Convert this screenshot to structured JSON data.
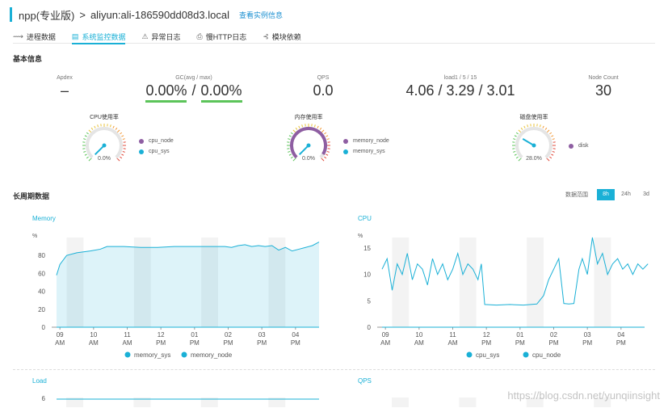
{
  "header": {
    "app_title": "npp(专业版)",
    "separator": ">",
    "host": "aliyun:ali-186590dd08d3.local",
    "instance_link": "查看实例信息"
  },
  "tabs": [
    {
      "label": "进程数据",
      "icon": "pulse-icon",
      "glyph": "⟿"
    },
    {
      "label": "系统监控数据",
      "icon": "list-icon",
      "glyph": "▤",
      "active": true
    },
    {
      "label": "异常日志",
      "icon": "warning-icon",
      "glyph": "⚠"
    },
    {
      "label": "慢HTTP日志",
      "icon": "printer-icon",
      "glyph": "⎙"
    },
    {
      "label": "模块依赖",
      "icon": "share-icon",
      "glyph": "⊰"
    }
  ],
  "basic": {
    "section_title": "基本信息",
    "apdex": {
      "label": "Apdex",
      "value": "–"
    },
    "gc": {
      "label": "GC(avg / max)",
      "avg": "0.00%",
      "slash": "/",
      "max": "0.00%"
    },
    "qps": {
      "label": "QPS",
      "value": "0.0"
    },
    "load": {
      "label": "load1 / 5 / 15",
      "value": "4.06 / 3.29 / 3.01"
    },
    "node_count": {
      "label": "Node Count",
      "value": "30"
    }
  },
  "gauges": [
    {
      "title": "CPU使用率",
      "value_text": "0.0%",
      "value": 0.0,
      "fill": 0.0,
      "legend": [
        {
          "label": "cpu_node",
          "color": "#8e5ea2"
        },
        {
          "label": "cpu_sys",
          "color": "#1ab0d6"
        }
      ]
    },
    {
      "title": "内存使用率",
      "value_text": "0.0%",
      "value": 0.0,
      "fill": 0.95,
      "legend": [
        {
          "label": "memory_node",
          "color": "#8e5ea2"
        },
        {
          "label": "memory_sys",
          "color": "#1ab0d6"
        }
      ]
    },
    {
      "title": "磁盘使用率",
      "value_text": "28.0%",
      "value": 28.0,
      "fill": 0.0,
      "legend": [
        {
          "label": "disk",
          "color": "#8e5ea2"
        }
      ]
    }
  ],
  "long_period": {
    "section_title": "长周期数据",
    "range_label": "数据范围",
    "ranges": [
      "8h",
      "24h",
      "3d"
    ],
    "active_range": "8h"
  },
  "colors": {
    "accent": "#1ab0d6",
    "gc_underline": "#5cc45a",
    "node": "#8e5ea2"
  },
  "chart_data": [
    {
      "type": "area",
      "title": "Memory",
      "ylabel": "%",
      "ylim": [
        0,
        100
      ],
      "yticks": [
        0,
        20,
        40,
        60,
        80
      ],
      "xticks": [
        "09\nAM",
        "10\nAM",
        "11\nAM",
        "12\nPM",
        "01\nPM",
        "02\nPM",
        "03\nPM",
        "04\nPM"
      ],
      "x": [
        0,
        0.1,
        0.3,
        0.6,
        1,
        1.3,
        1.5,
        2,
        2.5,
        3,
        3.5,
        4,
        4.5,
        5,
        5.2,
        5.4,
        5.6,
        5.8,
        6.0,
        6.2,
        6.4,
        6.6,
        6.8,
        7.0,
        7.2,
        7.4,
        7.6,
        7.8
      ],
      "series": [
        {
          "name": "memory_sys",
          "values": [
            58,
            70,
            80,
            83,
            85,
            87,
            90,
            90,
            89,
            89,
            90,
            90,
            90,
            90,
            89,
            91,
            92,
            90,
            91,
            90,
            91,
            86,
            89,
            85,
            87,
            89,
            91,
            95
          ]
        },
        {
          "name": "memory_node",
          "values": [
            0,
            0,
            0,
            0,
            0,
            0,
            0,
            0,
            0,
            0,
            0,
            0,
            0,
            0,
            0,
            0,
            0,
            0,
            0,
            0,
            0,
            0,
            0,
            0,
            0,
            0,
            0,
            0
          ]
        }
      ],
      "legend": [
        "memory_sys",
        "memory_node"
      ]
    },
    {
      "type": "line",
      "title": "CPU",
      "ylabel": "%",
      "ylim": [
        0,
        17
      ],
      "yticks": [
        0,
        5,
        10,
        15
      ],
      "xticks": [
        "09\nAM",
        "10\nAM",
        "11\nAM",
        "12\nPM",
        "01\nPM",
        "02\nPM",
        "03\nPM",
        "04\nPM"
      ],
      "x": [
        0,
        0.15,
        0.3,
        0.45,
        0.6,
        0.75,
        0.9,
        1.05,
        1.2,
        1.35,
        1.5,
        1.65,
        1.8,
        1.95,
        2.1,
        2.25,
        2.4,
        2.55,
        2.7,
        2.85,
        2.95,
        3.05,
        3.4,
        3.8,
        4.2,
        4.6,
        4.8,
        4.95,
        5.1,
        5.25,
        5.4,
        5.55,
        5.7,
        5.85,
        5.95,
        6.1,
        6.25,
        6.4,
        6.55,
        6.7,
        6.85,
        7.0,
        7.15,
        7.3,
        7.45,
        7.6,
        7.75,
        7.9
      ],
      "series": [
        {
          "name": "cpu_sys",
          "values": [
            11,
            13,
            7,
            12,
            10,
            14,
            9,
            12,
            11,
            8,
            13,
            10,
            12,
            9,
            11,
            14,
            10,
            12,
            11,
            9,
            12,
            4.3,
            4.2,
            4.3,
            4.2,
            4.4,
            6,
            9,
            11,
            13,
            4.5,
            4.4,
            4.5,
            11,
            13,
            10,
            17,
            12,
            14,
            10,
            12,
            13,
            11,
            12,
            10,
            12,
            11,
            12
          ]
        },
        {
          "name": "cpu_node",
          "values": [
            0,
            0,
            0,
            0,
            0,
            0,
            0,
            0,
            0,
            0,
            0,
            0,
            0,
            0,
            0,
            0,
            0,
            0,
            0,
            0,
            0,
            0,
            0,
            0,
            0,
            0,
            0,
            0,
            0,
            0,
            0,
            0,
            0,
            0,
            0,
            0,
            0,
            0,
            0,
            0,
            0,
            0,
            0,
            0,
            0,
            0,
            0,
            0
          ]
        }
      ],
      "legend": [
        "cpu_sys",
        "cpu_node"
      ]
    },
    {
      "type": "line",
      "title": "Load",
      "yticks": [
        6
      ]
    },
    {
      "type": "line",
      "title": "QPS"
    }
  ],
  "watermark": "https://blog.csdn.net/yunqiinsight"
}
